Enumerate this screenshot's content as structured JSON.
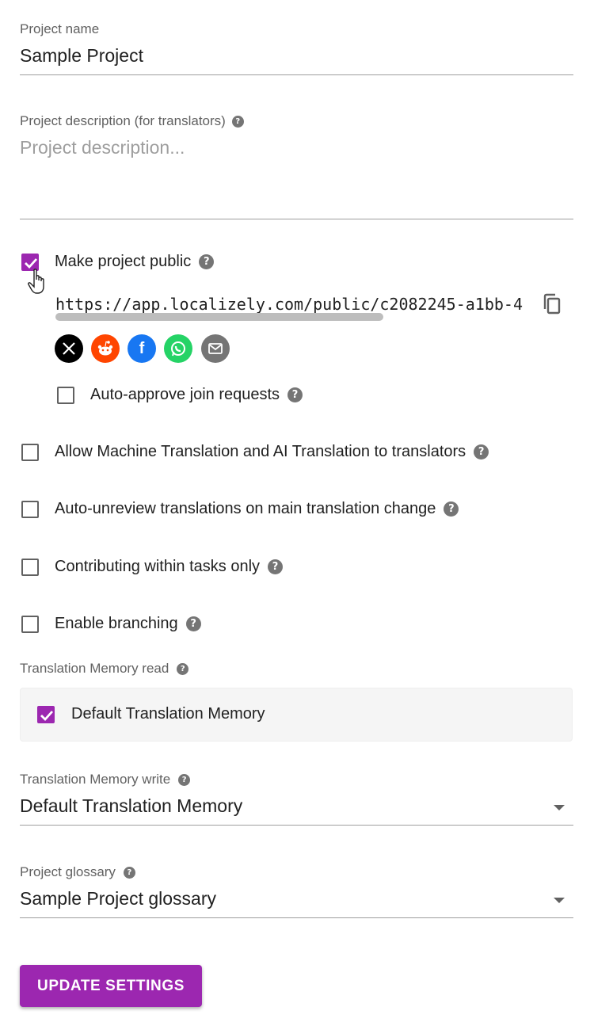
{
  "project_name": {
    "label": "Project name",
    "value": "Sample Project"
  },
  "project_description": {
    "label": "Project description (for translators)",
    "placeholder": "Project description..."
  },
  "make_public": {
    "label": "Make project public",
    "checked": true,
    "url": "https://app.localizely.com/public/c2082245-a1bb-4"
  },
  "share_icons": [
    {
      "name": "x-icon",
      "glyph": "𝕏",
      "color": "#000000"
    },
    {
      "name": "reddit-icon",
      "glyph": "●",
      "color": "#ff4500"
    },
    {
      "name": "facebook-icon",
      "glyph": "f",
      "color": "#1877f2"
    },
    {
      "name": "whatsapp-icon",
      "glyph": "✆",
      "color": "#25d366"
    },
    {
      "name": "email-icon",
      "glyph": "✉",
      "color": "#757575"
    }
  ],
  "options": {
    "auto_approve": "Auto-approve join requests",
    "allow_mt": "Allow Machine Translation and AI Translation to translators",
    "auto_unreview": "Auto-unreview translations on main translation change",
    "tasks_only": "Contributing within tasks only",
    "branching": "Enable branching"
  },
  "tm_read": {
    "label": "Translation Memory read",
    "item": "Default Translation Memory",
    "checked": true
  },
  "tm_write": {
    "label": "Translation Memory write",
    "value": "Default Translation Memory"
  },
  "glossary": {
    "label": "Project glossary",
    "value": "Sample Project glossary"
  },
  "help_glyph": "?",
  "update_button": "UPDATE SETTINGS",
  "colors": {
    "accent": "#9c27b0"
  }
}
